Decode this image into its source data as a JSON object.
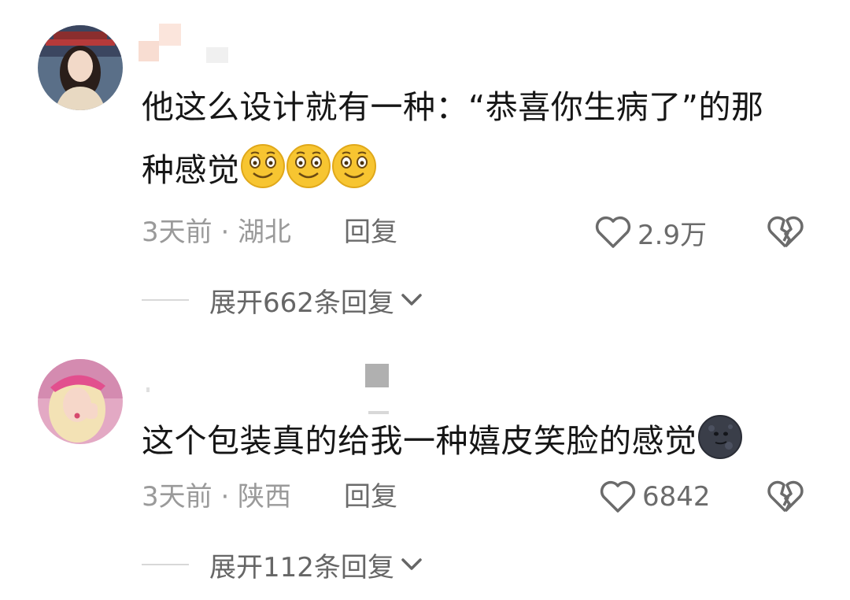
{
  "comments": [
    {
      "text_line1": "他这么设计就有一种：“恭喜你生病了”的那",
      "text_line2": "种感觉",
      "emojis": [
        "smiling-face-emoji",
        "smiling-face-emoji",
        "smiling-face-emoji"
      ],
      "time_location": "3天前 · 湖北",
      "reply_label": "回复",
      "like_count": "2.9万",
      "expand_label": "展开662条回复"
    },
    {
      "text_line1": "这个包装真的给我一种嬉皮笑脸的感觉",
      "emojis": [
        "new-moon-face-emoji"
      ],
      "time_location": "3天前 · 陕西",
      "reply_label": "回复",
      "like_count": "6842",
      "expand_label": "展开112条回复"
    }
  ],
  "colors": {
    "text": "#161616",
    "meta": "#9a9a9a",
    "secondary": "#6b6b6b",
    "emoji_yellow": "#f7c531",
    "moon_dark": "#3a3e49"
  }
}
